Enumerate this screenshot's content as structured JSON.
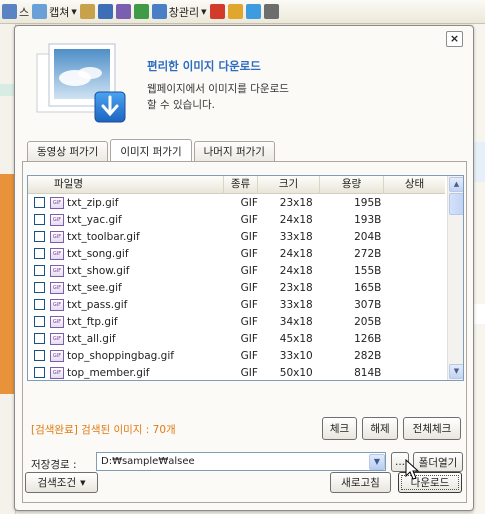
{
  "browser_toolbar": {
    "items": [
      {
        "label": "스",
        "icon": "unknown-icon",
        "color": "#5a83c4"
      },
      {
        "label": "캡쳐",
        "icon": "capture-icon",
        "color": "#6aa0d8",
        "caret": true
      },
      {
        "label": "",
        "icon": "broom-icon",
        "color": "#c8a24a"
      },
      {
        "label": "",
        "icon": "save-icon",
        "color": "#3d6fb6"
      },
      {
        "label": "",
        "icon": "document-icon",
        "color": "#7a5fb0"
      },
      {
        "label": "",
        "icon": "excel-icon",
        "color": "#3f9b48"
      },
      {
        "label": "창관리",
        "icon": "window-icon",
        "color": "#4a7fc8",
        "caret": true
      },
      {
        "label": "",
        "icon": "record-icon",
        "color": "#d23a2a"
      },
      {
        "label": "",
        "icon": "note-icon",
        "color": "#e0a72e"
      },
      {
        "label": "",
        "icon": "twitter-icon",
        "color": "#3d9be0"
      },
      {
        "label": "",
        "icon": "arrow-down-circle-icon",
        "color": "#6d6d6d"
      }
    ]
  },
  "dialog": {
    "close_label": "×",
    "title": "편리한 이미지 다운로드",
    "description_line1": "웹페이지에서 이미지를 다운로드",
    "description_line2": "할 수 있습니다.",
    "tabs": [
      {
        "label": "동영상 퍼가기",
        "active": false
      },
      {
        "label": "이미지 퍼가기",
        "active": true
      },
      {
        "label": "나머지 퍼가기",
        "active": false
      }
    ],
    "list": {
      "columns": {
        "name": "파일명",
        "type": "종류",
        "size": "크기",
        "bytes": "용량",
        "state": "상태"
      },
      "rows": [
        {
          "name": "txt_zip.gif",
          "type": "GIF",
          "size": "23x18",
          "bytes": "195B",
          "state": ""
        },
        {
          "name": "txt_yac.gif",
          "type": "GIF",
          "size": "24x18",
          "bytes": "193B",
          "state": ""
        },
        {
          "name": "txt_toolbar.gif",
          "type": "GIF",
          "size": "33x18",
          "bytes": "204B",
          "state": ""
        },
        {
          "name": "txt_song.gif",
          "type": "GIF",
          "size": "24x18",
          "bytes": "272B",
          "state": ""
        },
        {
          "name": "txt_show.gif",
          "type": "GIF",
          "size": "24x18",
          "bytes": "155B",
          "state": ""
        },
        {
          "name": "txt_see.gif",
          "type": "GIF",
          "size": "23x18",
          "bytes": "165B",
          "state": ""
        },
        {
          "name": "txt_pass.gif",
          "type": "GIF",
          "size": "33x18",
          "bytes": "307B",
          "state": ""
        },
        {
          "name": "txt_ftp.gif",
          "type": "GIF",
          "size": "34x18",
          "bytes": "205B",
          "state": ""
        },
        {
          "name": "txt_all.gif",
          "type": "GIF",
          "size": "45x18",
          "bytes": "126B",
          "state": ""
        },
        {
          "name": "top_shoppingbag.gif",
          "type": "GIF",
          "size": "33x10",
          "bytes": "282B",
          "state": ""
        },
        {
          "name": "top_member.gif",
          "type": "GIF",
          "size": "50x10",
          "bytes": "814B",
          "state": ""
        }
      ]
    },
    "result_text": "[검색완료] 검색된 이미지 : 70개",
    "buttons": {
      "check": "체크",
      "uncheck": "해제",
      "check_all": "전체체크",
      "browse": "...",
      "open_folder": "폴더열기",
      "search_condition": "검색조건",
      "refresh": "새로고침",
      "download": "다운로드"
    },
    "path_label": "저장경로 :",
    "path_value": "D:₩sample₩alsee"
  },
  "colors": {
    "accent_blue": "#2b6cc0",
    "result_orange": "#e07b12"
  }
}
